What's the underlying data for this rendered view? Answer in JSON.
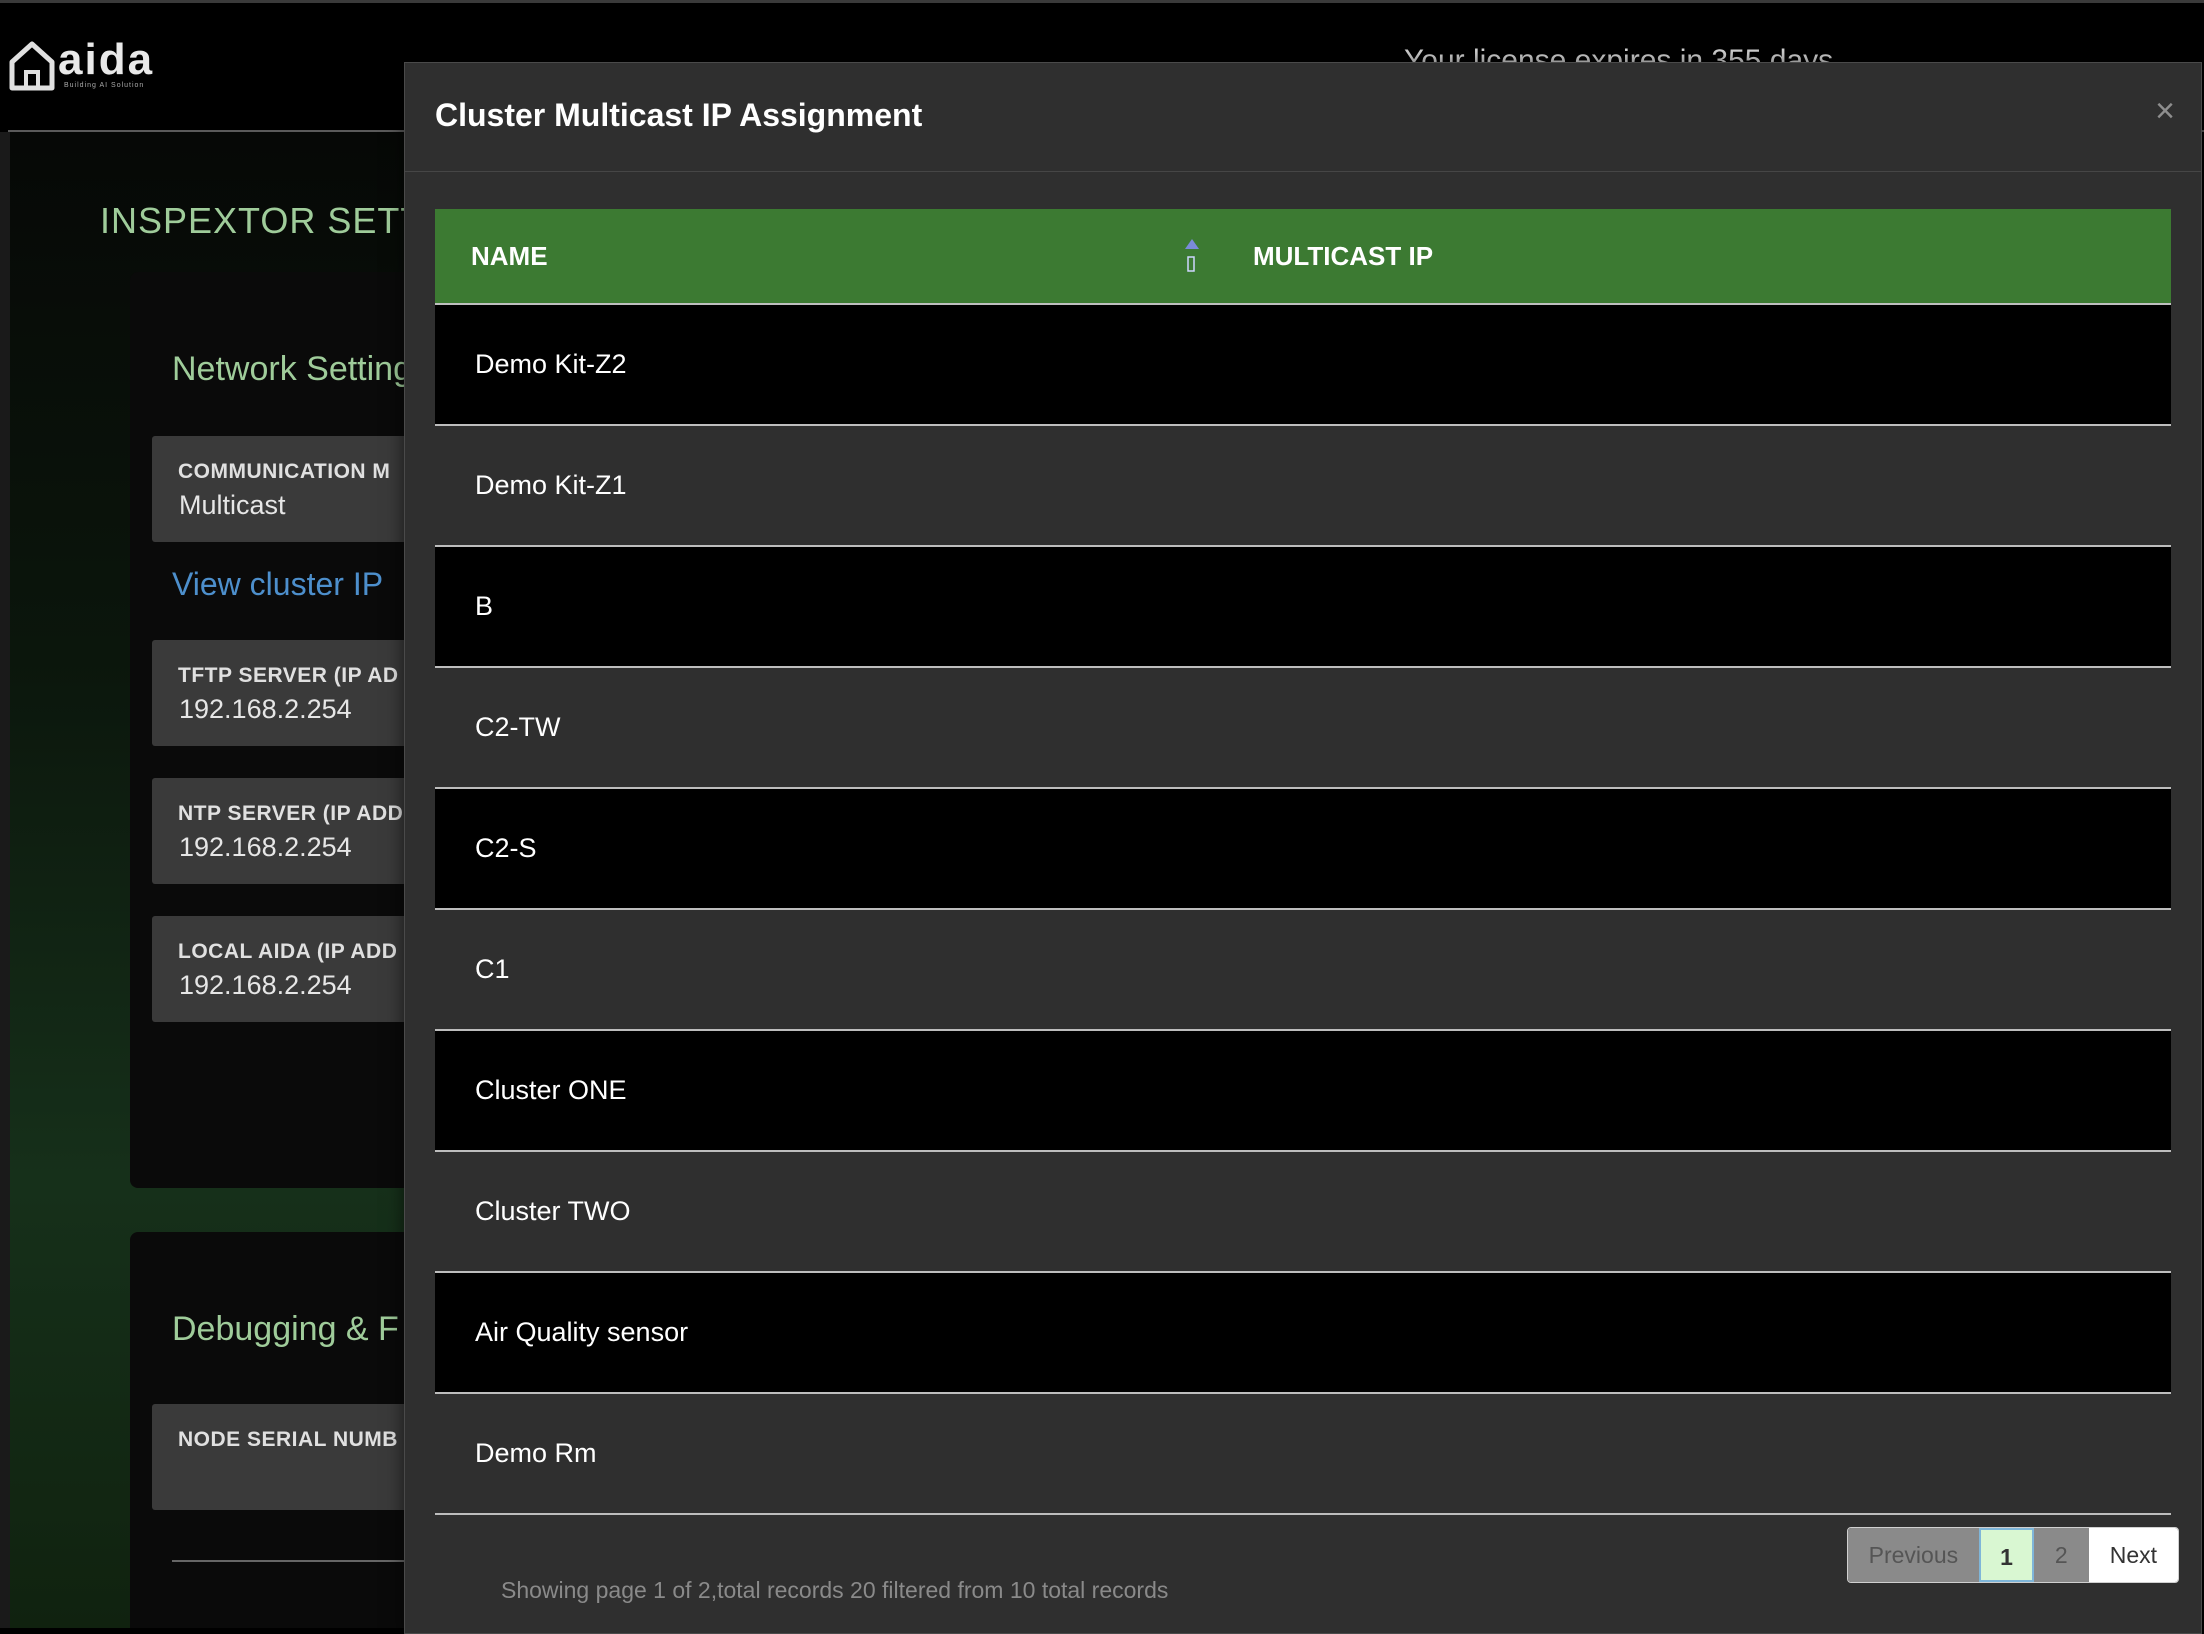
{
  "app": {
    "logo_text": "aida",
    "logo_subtitle": "Building AI Solution",
    "license_text": "Your license expires in 355 days"
  },
  "page": {
    "title": "INSPEXTOR SETT",
    "network_section_title": "Network Setting",
    "fields": [
      {
        "label": "COMMUNICATION M",
        "value": "Multicast"
      },
      {
        "label": "TFTP SERVER (IP AD",
        "value": "192.168.2.254"
      },
      {
        "label": "NTP SERVER (IP ADD",
        "value": "192.168.2.254"
      },
      {
        "label": "LOCAL AIDA (IP ADD",
        "value": "192.168.2.254"
      }
    ],
    "view_cluster_link": "View cluster IP",
    "debug_section_title": "Debugging & F",
    "debug_field_label": "NODE SERIAL NUMB"
  },
  "modal": {
    "title": "Cluster Multicast IP Assignment",
    "close_glyph": "×",
    "columns": [
      "NAME",
      "MULTICAST IP"
    ],
    "rows": [
      {
        "name": "Demo Kit-Z2",
        "ip": ""
      },
      {
        "name": "Demo Kit-Z1",
        "ip": ""
      },
      {
        "name": "B",
        "ip": ""
      },
      {
        "name": "C2-TW",
        "ip": ""
      },
      {
        "name": "C2-S",
        "ip": ""
      },
      {
        "name": "C1",
        "ip": ""
      },
      {
        "name": "Cluster ONE",
        "ip": ""
      },
      {
        "name": "Cluster TWO",
        "ip": ""
      },
      {
        "name": "Air Quality sensor",
        "ip": ""
      },
      {
        "name": "Demo Rm",
        "ip": ""
      }
    ],
    "pagination": {
      "previous": "Previous",
      "pages": [
        "1",
        "2"
      ],
      "current_page": "1",
      "next": "Next"
    },
    "info": "Showing page 1 of 2,total records 20 filtered from 10 total records"
  },
  "colors": {
    "header_green": "#3c7a32",
    "accent_green": "#9fcc9a",
    "link_blue": "#4d8fcc"
  }
}
